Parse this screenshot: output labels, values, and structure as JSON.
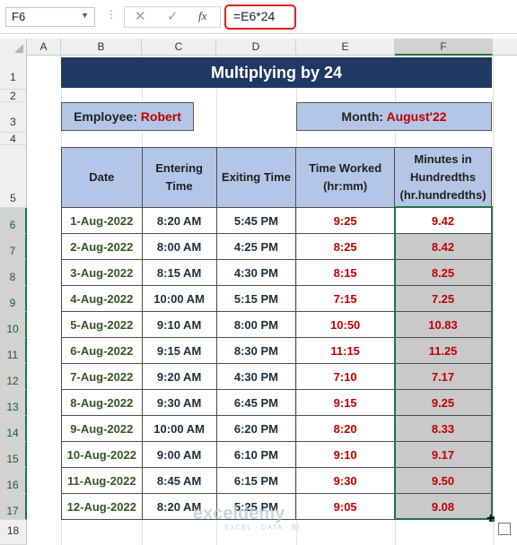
{
  "formula_bar": {
    "name_box": "F6",
    "dots": "⋮",
    "cancel_glyph": "✕",
    "enter_glyph": "✓",
    "fx_label": "fx",
    "formula": "=E6*24"
  },
  "grid": {
    "columns": [
      "A",
      "B",
      "C",
      "D",
      "E",
      "F"
    ],
    "selected_column": "F",
    "rows": [
      "1",
      "2",
      "3",
      "4",
      "5",
      "6",
      "7",
      "8",
      "9",
      "10",
      "11",
      "12",
      "13",
      "14",
      "15",
      "16",
      "17",
      "18"
    ]
  },
  "sheet": {
    "title": "Multiplying by 24",
    "employee_label": "Employee:",
    "employee_name": "Robert",
    "month_label": "Month:",
    "month_value": "August'22"
  },
  "table": {
    "headers": [
      "Date",
      "Entering Time",
      "Exiting Time",
      "Time Worked (hr:mm)",
      "Minutes in Hundredths (hr.hundredths)"
    ],
    "rows": [
      [
        "1-Aug-2022",
        "8:20 AM",
        "5:45 PM",
        "9:25",
        "9.42"
      ],
      [
        "2-Aug-2022",
        "8:00 AM",
        "4:25 PM",
        "8:25",
        "8.42"
      ],
      [
        "3-Aug-2022",
        "8:15 AM",
        "4:30 PM",
        "8:15",
        "8.25"
      ],
      [
        "4-Aug-2022",
        "10:00 AM",
        "5:15 PM",
        "7:15",
        "7.25"
      ],
      [
        "5-Aug-2022",
        "9:10 AM",
        "8:00 PM",
        "10:50",
        "10.83"
      ],
      [
        "6-Aug-2022",
        "9:15 AM",
        "8:30 PM",
        "11:15",
        "11.25"
      ],
      [
        "7-Aug-2022",
        "9:20 AM",
        "4:30 PM",
        "7:10",
        "7.17"
      ],
      [
        "8-Aug-2022",
        "9:30 AM",
        "6:45 PM",
        "9:15",
        "9.25"
      ],
      [
        "9-Aug-2022",
        "10:00 AM",
        "6:20 PM",
        "8:20",
        "8.33"
      ],
      [
        "10-Aug-2022",
        "9:00 AM",
        "6:10 PM",
        "9:10",
        "9.17"
      ],
      [
        "11-Aug-2022",
        "8:45 AM",
        "6:15 PM",
        "9:30",
        "9.50"
      ],
      [
        "12-Aug-2022",
        "8:20 AM",
        "5:25 PM",
        "9:05",
        "9.08"
      ]
    ]
  },
  "watermark": {
    "brand": "exceldemy",
    "tagline": "EXCEL · DATA · BI"
  },
  "colors": {
    "title_bg": "#1f3864",
    "header_bg": "#b4c6e7",
    "accent_red": "#c00000",
    "selection_green": "#217346",
    "selected_cells_bg": "#c9c9c9"
  }
}
